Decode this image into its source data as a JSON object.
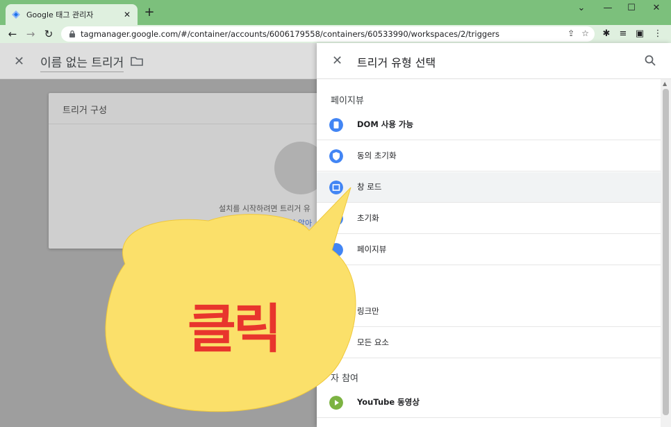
{
  "browser": {
    "tab_title": "Google 태그 관리자",
    "tab_close": "✕",
    "new_tab": "+",
    "url": "tagmanager.google.com/#/container/accounts/6006179558/containers/60533990/workspaces/2/triggers",
    "window_controls": {
      "menu": "⌄",
      "minimize": "—",
      "maximize": "☐",
      "close": "✕"
    },
    "nav": {
      "back": "←",
      "forward": "→",
      "reload": "↻"
    },
    "omni_icons": [
      "⇪",
      "☆"
    ],
    "extensions": [
      "✱",
      "≡",
      "▣",
      "⋮"
    ]
  },
  "editor": {
    "close": "✕",
    "title": "이름 없는 트리거",
    "card_title": "트리거 구성",
    "card_text": "설치를 시작하려면 트리거 유",
    "card_link": "자세히 알아"
  },
  "panel": {
    "close": "✕",
    "title": "트리거 유형 선택",
    "section_pageview": "페이지뷰",
    "section_engagement": "자 참여",
    "items": [
      {
        "label": "DOM 사용 가능",
        "icon": "document-icon",
        "color": "#4285f4"
      },
      {
        "label": "동의 초기화",
        "icon": "shield-icon",
        "color": "#4285f4"
      },
      {
        "label": "창 로드",
        "icon": "window-icon",
        "color": "#4285f4"
      },
      {
        "label": "초기화",
        "icon": "init-icon",
        "color": "#4285f4"
      },
      {
        "label": "페이지뷰",
        "icon": "eye-icon",
        "color": "#4285f4"
      },
      {
        "label": "링크만",
        "icon": "link-icon",
        "color": "#fbbf24"
      },
      {
        "label": "모든 요소",
        "icon": "cursor-icon",
        "color": "#fbbf24"
      },
      {
        "label": "YouTube 동영상",
        "icon": "play-icon",
        "color": "#7cb342"
      }
    ]
  },
  "annotation": {
    "text": "클릭",
    "bubble_color": "#fbe06a",
    "text_color": "#e8352d"
  }
}
